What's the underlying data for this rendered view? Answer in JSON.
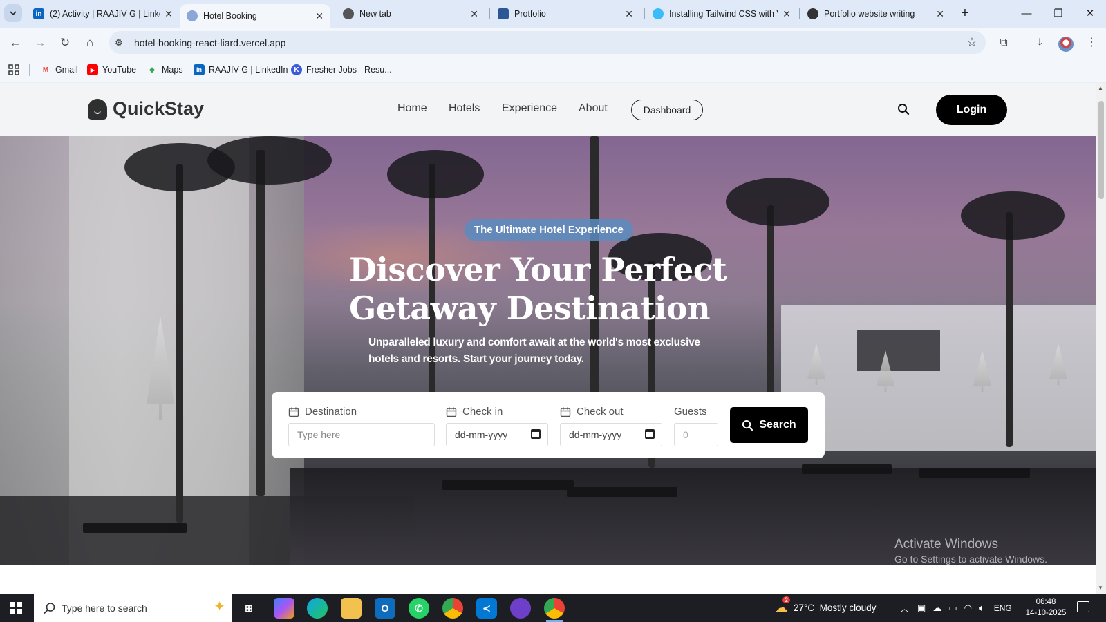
{
  "browser": {
    "tabs": [
      {
        "title": "(2) Activity | RAAJIV G | Linke",
        "icon": "linkedin-icon",
        "color": "#0a66c2"
      },
      {
        "title": "Hotel Booking",
        "icon": "site-icon",
        "color": "#8ba6d8",
        "active": true
      },
      {
        "title": "New tab",
        "icon": "chrome-icon",
        "color": "#555555"
      },
      {
        "title": "Protfolio",
        "icon": "folder-icon",
        "color": "#2b5797"
      },
      {
        "title": "Installing Tailwind CSS with V",
        "icon": "tailwind-icon",
        "color": "#38bdf8"
      },
      {
        "title": "Portfolio website writing",
        "icon": "chatgpt-icon",
        "color": "#333333"
      }
    ],
    "url": "hotel-booking-react-liard.vercel.app",
    "bookmarks": [
      {
        "label": "Gmail",
        "color": "#ea4335",
        "glyph": "M"
      },
      {
        "label": "YouTube",
        "color": "#ff0000",
        "glyph": "▶"
      },
      {
        "label": "Maps",
        "color": "#34a853",
        "glyph": "◆"
      },
      {
        "label": "RAAJIV G | LinkedIn",
        "color": "#0a66c2",
        "glyph": "in"
      },
      {
        "label": "Fresher Jobs - Resu...",
        "color": "#3b5bdb",
        "glyph": "K"
      }
    ]
  },
  "site": {
    "brand": "QuickStay",
    "nav": [
      "Home",
      "Hotels",
      "Experience",
      "About"
    ],
    "dashboard_label": "Dashboard",
    "login_label": "Login"
  },
  "hero": {
    "badge": "The Ultimate Hotel Experience",
    "title_line1": "Discover Your Perfect",
    "title_line2": "Getaway Destination",
    "subtitle": "Unparalleled luxury and comfort await at the world's most exclusive hotels and resorts. Start your journey today."
  },
  "booking": {
    "destination_label": "Destination",
    "destination_placeholder": "Type here",
    "checkin_label": "Check in",
    "checkin_placeholder": "dd-mm-yyyy",
    "checkout_label": "Check out",
    "checkout_placeholder": "dd-mm-yyyy",
    "guests_label": "Guests",
    "guests_placeholder": "0",
    "search_label": "Search"
  },
  "watermark": {
    "line1": "Activate Windows",
    "line2": "Go to Settings to activate Windows."
  },
  "taskbar": {
    "search_placeholder": "Type here to search",
    "weather": "27°C  Mostly cloudy",
    "weather_badge": "2",
    "language": "ENG",
    "time": "06:48",
    "date": "14-10-2025"
  }
}
